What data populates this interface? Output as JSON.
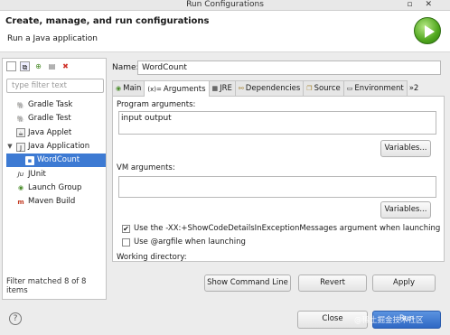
{
  "window": {
    "title": "Run Configurations"
  },
  "header": {
    "title": "Create, manage, and run configurations",
    "subtitle": "Run a Java application"
  },
  "left": {
    "toolbar_icons": [
      "new-config-icon",
      "duplicate-icon",
      "new-prototype-icon",
      "collapse-icon",
      "delete-icon"
    ],
    "filter_placeholder": "type filter text",
    "tree": [
      {
        "label": "Gradle Task",
        "icon": "gradle-icon",
        "level": 0,
        "expandable": false
      },
      {
        "label": "Gradle Test",
        "icon": "gradle-icon",
        "level": 0,
        "expandable": false
      },
      {
        "label": "Java Applet",
        "icon": "applet-icon",
        "level": 0,
        "expandable": false
      },
      {
        "label": "Java Application",
        "icon": "java-app-icon",
        "level": 0,
        "expandable": true,
        "expanded": true
      },
      {
        "label": "WordCount",
        "icon": "java-class-icon",
        "level": 1,
        "selected": true
      },
      {
        "label": "JUnit",
        "icon": "junit-icon",
        "level": 0
      },
      {
        "label": "Launch Group",
        "icon": "launch-group-icon",
        "level": 0
      },
      {
        "label": "Maven Build",
        "icon": "maven-icon",
        "level": 0
      }
    ],
    "filter_status": "Filter matched 8 of 8 items"
  },
  "right": {
    "name_label": "Name:",
    "name_value": "WordCount",
    "tabs": [
      {
        "label": "Main",
        "icon": "main-tab-icon"
      },
      {
        "label": "Arguments",
        "icon": "arguments-tab-icon",
        "active": true
      },
      {
        "label": "JRE",
        "icon": "jre-tab-icon"
      },
      {
        "label": "Dependencies",
        "icon": "dependencies-tab-icon"
      },
      {
        "label": "Source",
        "icon": "source-tab-icon"
      },
      {
        "label": "Environment",
        "icon": "environment-tab-icon"
      },
      {
        "label": "»2",
        "icon": "overflow-tab-icon"
      }
    ],
    "program_args_label": "Program arguments:",
    "program_args_value": "input output",
    "variables_label": "Variables...",
    "vm_args_label": "VM arguments:",
    "vm_args_value": "",
    "vm_variables_label": "Variables...",
    "show_code_details_label": "Use the -XX:+ShowCodeDetailsInExceptionMessages argument when launching",
    "show_code_details_checked": true,
    "argfile_label": "Use @argfile when launching",
    "argfile_checked": false,
    "working_dir_label": "Working directory:",
    "show_command_line_label": "Show Command Line",
    "revert_label": "Revert",
    "apply_label": "Apply"
  },
  "footer": {
    "help_label": "?",
    "close_label": "Close",
    "run_label": "Run",
    "watermark": "@稀土掘金技术社区"
  },
  "colors": {
    "selection": "#3d7ad3",
    "run_button": "#3d7ad3",
    "accent_green": "#4fa61d",
    "delete_red": "#d0332b"
  }
}
